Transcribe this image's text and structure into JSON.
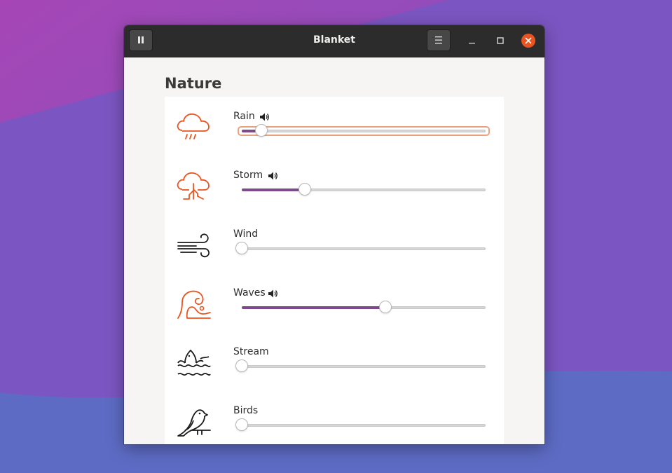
{
  "window": {
    "title": "Blanket",
    "play_pause_icon": "pause-icon",
    "menu_icon": "hamburger-menu-icon"
  },
  "colors": {
    "accent": "#e95420",
    "slider_fill": "#7e4a8c",
    "titlebar": "#2c2c2c",
    "icon_orange": "#e95420",
    "icon_black": "#1a1a1a"
  },
  "section": {
    "title": "Nature"
  },
  "sounds": [
    {
      "name": "Rain",
      "icon": "rain-cloud-icon",
      "volume": 0.08,
      "playing": true,
      "focused": true
    },
    {
      "name": "Storm",
      "icon": "storm-cloud-icon",
      "volume": 0.26,
      "playing": true,
      "focused": false
    },
    {
      "name": "Wind",
      "icon": "wind-icon",
      "volume": 0.0,
      "playing": false,
      "focused": false
    },
    {
      "name": "Waves",
      "icon": "wave-icon",
      "volume": 0.59,
      "playing": true,
      "focused": false
    },
    {
      "name": "Stream",
      "icon": "stream-fish-icon",
      "volume": 0.0,
      "playing": false,
      "focused": false
    },
    {
      "name": "Birds",
      "icon": "bird-icon",
      "volume": 0.0,
      "playing": false,
      "focused": false
    }
  ]
}
